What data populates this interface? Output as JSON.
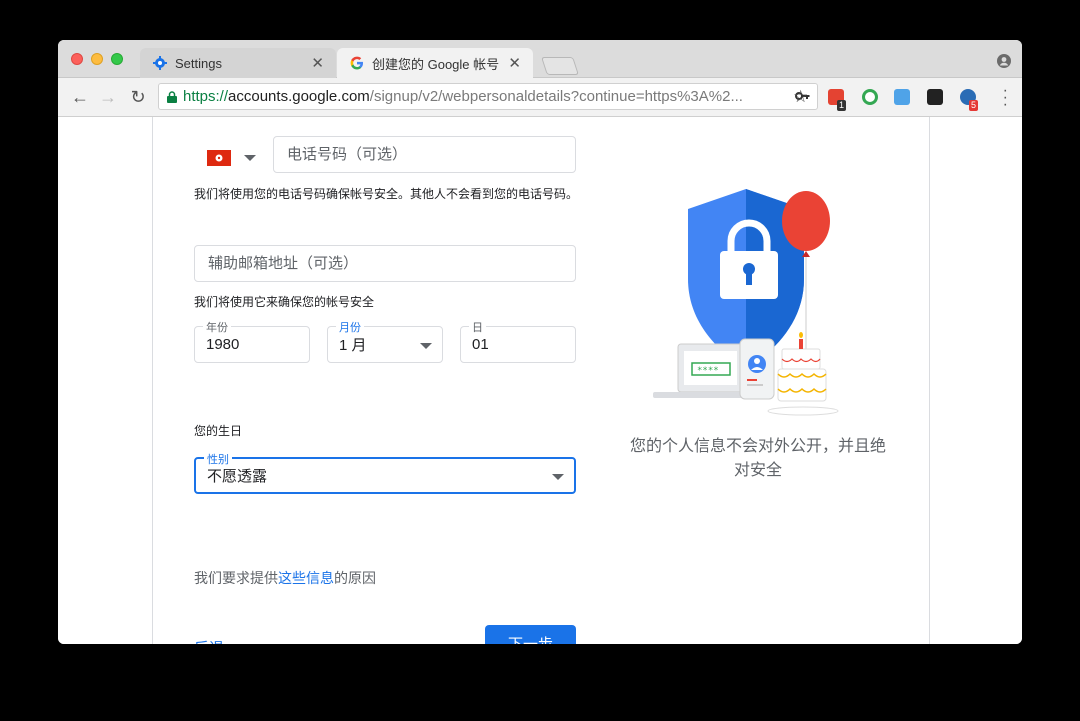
{
  "browser": {
    "tabs": [
      {
        "title": "Settings",
        "icon": "gear-icon",
        "active": false
      },
      {
        "title": "创建您的 Google 帐号",
        "icon": "google-g-icon",
        "active": true
      }
    ],
    "url": {
      "scheme": "https://",
      "host": "accounts.google.com",
      "path": "/signup/v2/webpersonaldetails?continue=https%3A%2..."
    },
    "extensions": [
      {
        "name": "todoist-icon",
        "badge": "1"
      },
      {
        "name": "chrome-green-icon",
        "badge": ""
      },
      {
        "name": "v-extension-icon",
        "badge": ""
      },
      {
        "name": "trello-icon",
        "badge": ""
      },
      {
        "name": "chrome-star-icon",
        "badge": "5"
      }
    ]
  },
  "form": {
    "phone_placeholder": "电话号码（可选）",
    "phone_helper": "我们将使用您的电话号码确保帐号安全。其他人不会看到您的电话号码。",
    "recovery_email_placeholder": "辅助邮箱地址（可选）",
    "recovery_email_helper": "我们将使用它来确保您的帐号安全",
    "year_label": "年份",
    "year_value": "1980",
    "month_label": "月份",
    "month_value": "1 月",
    "day_label": "日",
    "day_value": "01",
    "birthday_helper": "您的生日",
    "gender_label": "性别",
    "gender_value": "不愿透露",
    "why_prefix": "我们要求提供",
    "why_link": "这些信息",
    "why_suffix": "的原因",
    "back_label": "后退",
    "next_label": "下一步"
  },
  "side": {
    "caption": "您的个人信息不会对外公开，并且绝对安全"
  },
  "colors": {
    "accent": "#1a73e8",
    "shield": "#4285f4",
    "balloon": "#ea4335",
    "flag": "#de2910"
  }
}
